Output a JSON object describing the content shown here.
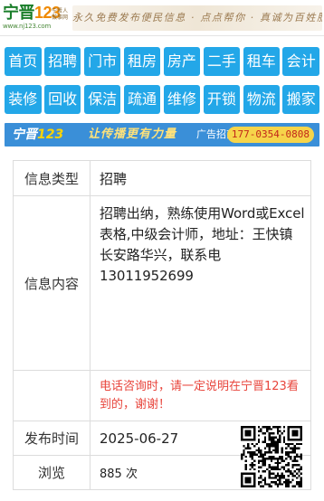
{
  "header": {
    "logo_name": "宁晋",
    "logo_num": "123",
    "logo_tagline": "宁晋人 做事网",
    "logo_url": "www.nj123.com",
    "slogan": "永久免费发布便民信息 · 点点帮你 · 真诚为百姓服务"
  },
  "nav": [
    [
      "首页",
      "招聘",
      "门市",
      "租房",
      "房产",
      "二手",
      "租车",
      "会计"
    ],
    [
      "装修",
      "回收",
      "保洁",
      "疏通",
      "维修",
      "开锁",
      "物流",
      "搬家"
    ]
  ],
  "ad": {
    "brand_name": "宁晋",
    "brand_num": "123",
    "slogan": "让传播更有力量",
    "label": "广告招商",
    "phone": "177-0354-0808"
  },
  "info": {
    "type_label": "信息类型",
    "type_value": "招聘",
    "content_label": "信息内容",
    "content_value": "招聘出纳，熟练使用Word或Excel表格,中级会计师，地址：王快镇长安路华兴，联系电13011952699",
    "notice": "电话咨询时，请一定说明在宁晋123看到的，谢谢！",
    "date_label": "发布时间",
    "date_value": "2025-06-27",
    "views_label": "浏览",
    "views_value": "885 次"
  },
  "qr_icon": "qr-code-icon"
}
